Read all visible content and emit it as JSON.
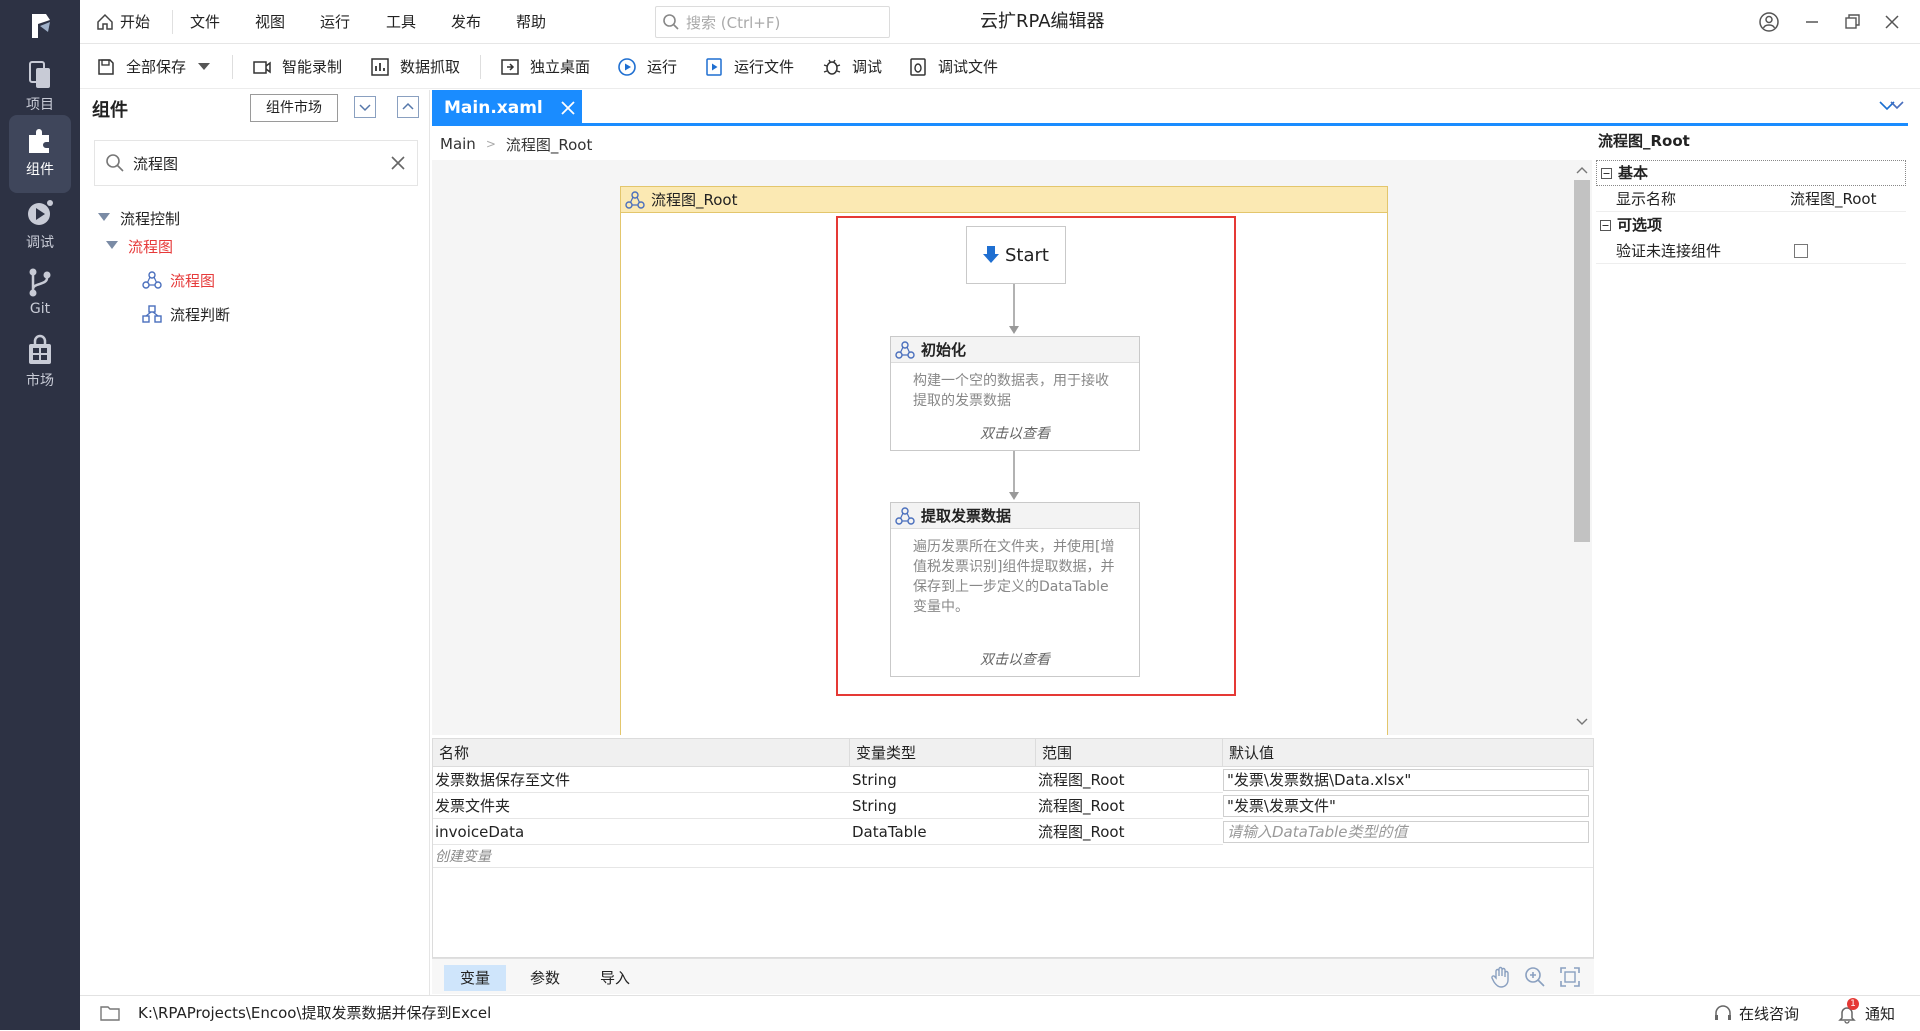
{
  "rail": {
    "items": [
      {
        "label": "项目"
      },
      {
        "label": "组件"
      },
      {
        "label": "调试"
      },
      {
        "label": "Git"
      },
      {
        "label": "市场"
      }
    ]
  },
  "menu": {
    "home": "开始",
    "file": "文件",
    "view": "视图",
    "run": "运行",
    "tools": "工具",
    "publish": "发布",
    "help": "帮助",
    "search_placeholder": "搜索 (Ctrl+F)",
    "app_title": "云扩RPA编辑器"
  },
  "toolbar": {
    "save_all": "全部保存",
    "smart_record": "智能录制",
    "data_capture": "数据抓取",
    "standalone_desktop": "独立桌面",
    "run": "运行",
    "run_file": "运行文件",
    "debug": "调试",
    "debug_file": "调试文件"
  },
  "components": {
    "title": "组件",
    "market_button": "组件市场",
    "search_value": "流程图",
    "tree": {
      "flow_control": "流程控制",
      "flowchart_group": "流程图",
      "flowchart": "流程图",
      "flow_decision": "流程判断"
    }
  },
  "editor": {
    "tab_label": "Main.xaml",
    "breadcrumb": [
      "Main",
      "流程图_Root"
    ],
    "flowchart_title": "流程图_Root",
    "start_label": "Start",
    "nodes": [
      {
        "title": "初始化",
        "description": "构建一个空的数据表，用于接收提取的发票数据",
        "hint": "双击以查看"
      },
      {
        "title": "提取发票数据",
        "description": "遍历发票所在文件夹，并使用[增值税发票识别]组件提取数据，并保存到上一步定义的DataTable变量中。",
        "hint": "双击以查看"
      }
    ]
  },
  "variables": {
    "headers": [
      "名称",
      "变量类型",
      "范围",
      "默认值"
    ],
    "rows": [
      {
        "name": "发票数据保存至文件",
        "type": "String",
        "scope": "流程图_Root",
        "default": "\"发票\\发票数据\\Data.xlsx\""
      },
      {
        "name": "发票文件夹",
        "type": "String",
        "scope": "流程图_Root",
        "default": "\"发票\\发票文件\""
      },
      {
        "name": "invoiceData",
        "type": "DataTable",
        "scope": "流程图_Root",
        "default_placeholder": "请输入DataTable类型的值"
      }
    ],
    "create_hint": "创建变量",
    "tabs": [
      "变量",
      "参数",
      "导入"
    ]
  },
  "properties": {
    "title": "流程图_Root",
    "basic_section": "基本",
    "display_name_label": "显示名称",
    "display_name_value": "流程图_Root",
    "optional_section": "可选项",
    "validate_label": "验证未连接组件",
    "validate_checked": false
  },
  "status": {
    "path": "K:\\RPAProjects\\Encoo\\提取发票数据并保存到Excel",
    "online_consult": "在线咨询",
    "notify": "通知",
    "notify_badge": "1"
  }
}
